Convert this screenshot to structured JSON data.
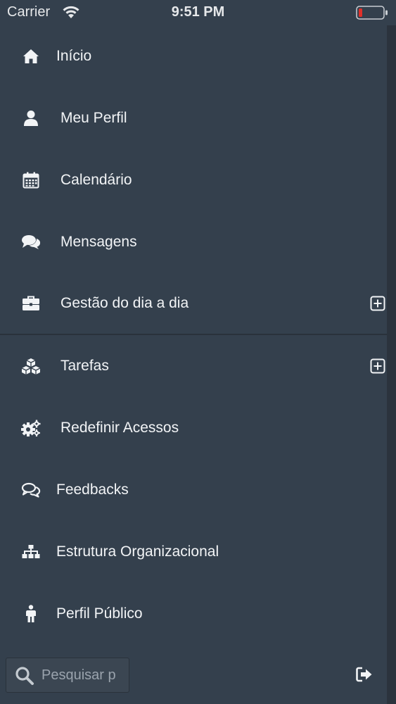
{
  "status_bar": {
    "carrier": "Carrier",
    "time": "9:51 PM",
    "battery_color": "#e0302a"
  },
  "menu": {
    "items": [
      {
        "label": "Início",
        "icon": "home-icon"
      },
      {
        "label": "Meu Perfil",
        "icon": "user-icon"
      },
      {
        "label": "Calendário",
        "icon": "calendar-icon"
      },
      {
        "label": "Mensagens",
        "icon": "comments-icon"
      },
      {
        "label": "Gestão do dia a dia",
        "icon": "briefcase-icon",
        "expandable": true
      },
      {
        "label": "Tarefas",
        "icon": "cubes-icon",
        "expandable": true
      },
      {
        "label": "Redefinir Acessos",
        "icon": "cogs-icon"
      },
      {
        "label": "Feedbacks",
        "icon": "comment-bubbles-icon"
      },
      {
        "label": "Estrutura Organizacional",
        "icon": "sitemap-icon"
      },
      {
        "label": "Perfil Público",
        "icon": "person-standing-icon"
      }
    ]
  },
  "search": {
    "placeholder": "Pesquisar p",
    "value": ""
  },
  "colors": {
    "background": "#34404d",
    "divider": "#2a323b",
    "text": "#f2f4f6"
  }
}
